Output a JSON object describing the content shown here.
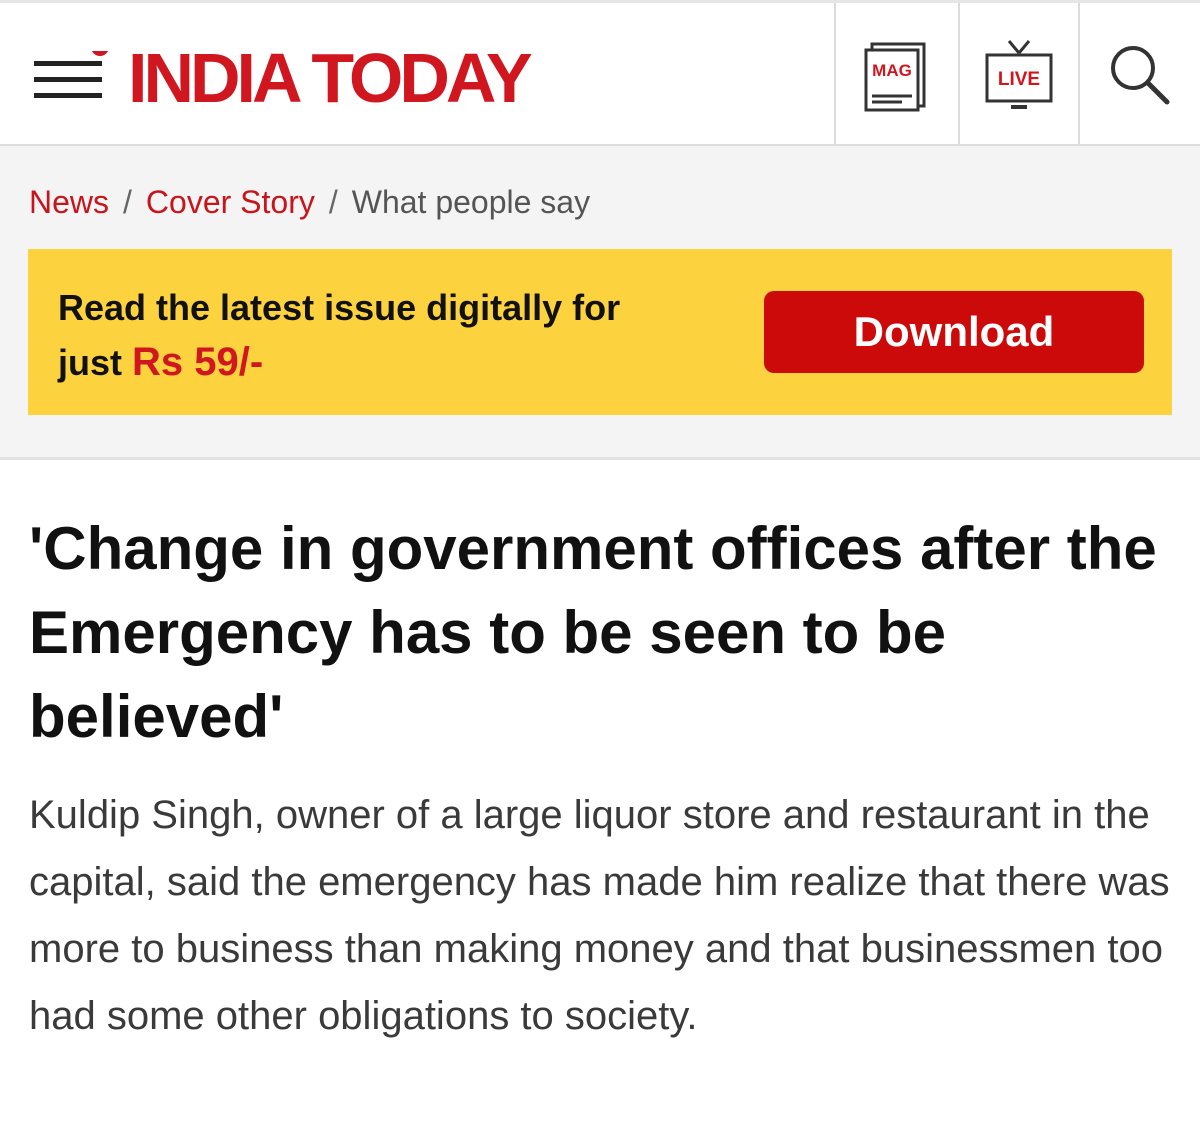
{
  "header": {
    "logo_text": "INDIA TODAY",
    "mag_icon_label": "MAG",
    "live_icon_label": "LIVE",
    "brand_color": "#d0161f"
  },
  "breadcrumb": {
    "items": [
      {
        "label": "News"
      },
      {
        "label": "Cover Story"
      },
      {
        "label": "What people say"
      }
    ],
    "separator": "/"
  },
  "banner": {
    "text_line1": "Read the latest issue digitally for",
    "text_prefix": "just ",
    "price": "Rs 59/-",
    "button_label": "Download",
    "background_color": "#fcd23e",
    "button_color": "#cc0a0a"
  },
  "article": {
    "headline": "'Change in government offices after the Emergency has to be seen to be believed'",
    "summary": "Kuldip Singh, owner of a large liquor store and restaurant in the capital, said the emergency has made him realize that there was more to business than making money and that businessmen too had some other obligations to society."
  }
}
